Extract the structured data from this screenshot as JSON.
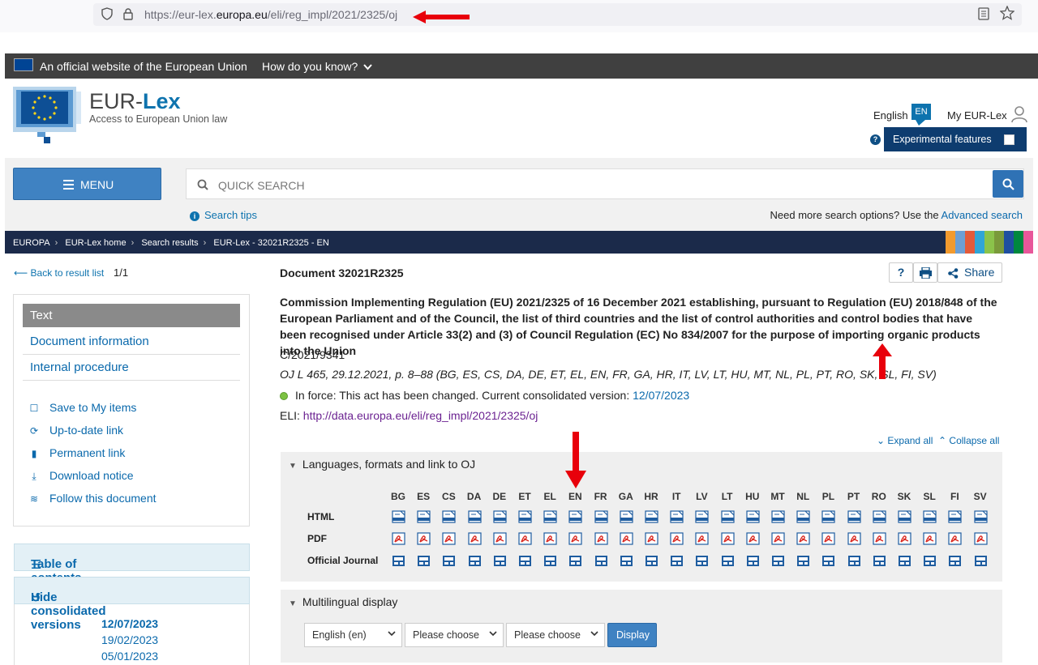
{
  "browser": {
    "url_prefix": "https://eur-lex.",
    "url_domain": "europa.eu",
    "url_path": "/eli/reg_impl/2021/2325/oj"
  },
  "eu_banner": {
    "official_text": "An official website of the European Union",
    "how_text": "How do you know?"
  },
  "header": {
    "logo_eur": "EUR-",
    "logo_lex": "Lex",
    "subtitle": "Access to European Union law",
    "language": "English",
    "language_code": "EN",
    "my_eurlex": "My EUR-Lex",
    "experimental": "Experimental features"
  },
  "search": {
    "menu_label": "MENU",
    "placeholder": "QUICK SEARCH",
    "tips": "Search tips",
    "need_more": "Need more search options? Use the ",
    "advanced": "Advanced search"
  },
  "breadcrumb": [
    "EUROPA",
    "EUR-Lex home",
    "Search results",
    "EUR-Lex - 32021R2325 - EN"
  ],
  "sidebar": {
    "back": "Back to result list",
    "count": "1/1",
    "active_tab": "Text",
    "links": [
      "Document information",
      "Internal procedure"
    ],
    "tools": [
      "Save to My items",
      "Up-to-date link",
      "Permanent link",
      "Download notice",
      "Follow this document"
    ],
    "toc": "Table of contents",
    "hide_consolidated": "Hide consolidated versions",
    "consolidated_dates": [
      "12/07/2023",
      "19/02/2023",
      "05/01/2023"
    ]
  },
  "document": {
    "number": "Document 32021R2325",
    "title": "Commission Implementing Regulation (EU) 2021/2325 of 16 December 2021 establishing, pursuant to Regulation (EU) 2018/848 of the European Parliament and of the Council, the list of third countries and the list of control authorities and control bodies that have been recognised under Article 33(2) and (3) of Council Regulation (EC) No 834/2007 for the purpose of importing organic products into the Union",
    "celex_ref": "C/2021/9341",
    "oj_ref": "OJ L 465, 29.12.2021, p. 8–88 (BG, ES, CS, DA, DE, ET, EL, EN, FR, GA, HR, IT, LV, LT, HU, MT, NL, PL, PT, RO, SK, SL, FI, SV)",
    "in_force": "In force: This act has been changed. Current consolidated version: ",
    "consolidated_version": "12/07/2023",
    "eli_label": "ELI: ",
    "eli_link": "http://data.europa.eu/eli/reg_impl/2021/2325/oj",
    "help": "?",
    "share": "Share",
    "expand_all": "Expand all",
    "collapse_all": "Collapse all"
  },
  "languages_panel": {
    "title": "Languages, formats and link to OJ",
    "codes": [
      "BG",
      "ES",
      "CS",
      "DA",
      "DE",
      "ET",
      "EL",
      "EN",
      "FR",
      "GA",
      "HR",
      "IT",
      "LV",
      "LT",
      "HU",
      "MT",
      "NL",
      "PL",
      "PT",
      "RO",
      "SK",
      "SL",
      "FI",
      "SV"
    ],
    "rows": [
      "HTML",
      "PDF",
      "Official Journal"
    ]
  },
  "multilingual": {
    "title": "Multilingual display",
    "select1": "English (en)",
    "select2": "Please choose",
    "select3": "Please choose",
    "display": "Display"
  },
  "colors": {
    "eu_blue": "#004494",
    "link": "#0a69ac",
    "breadcrumb_bg": "#1b2a4a",
    "annotation_red": "#e8000b"
  }
}
